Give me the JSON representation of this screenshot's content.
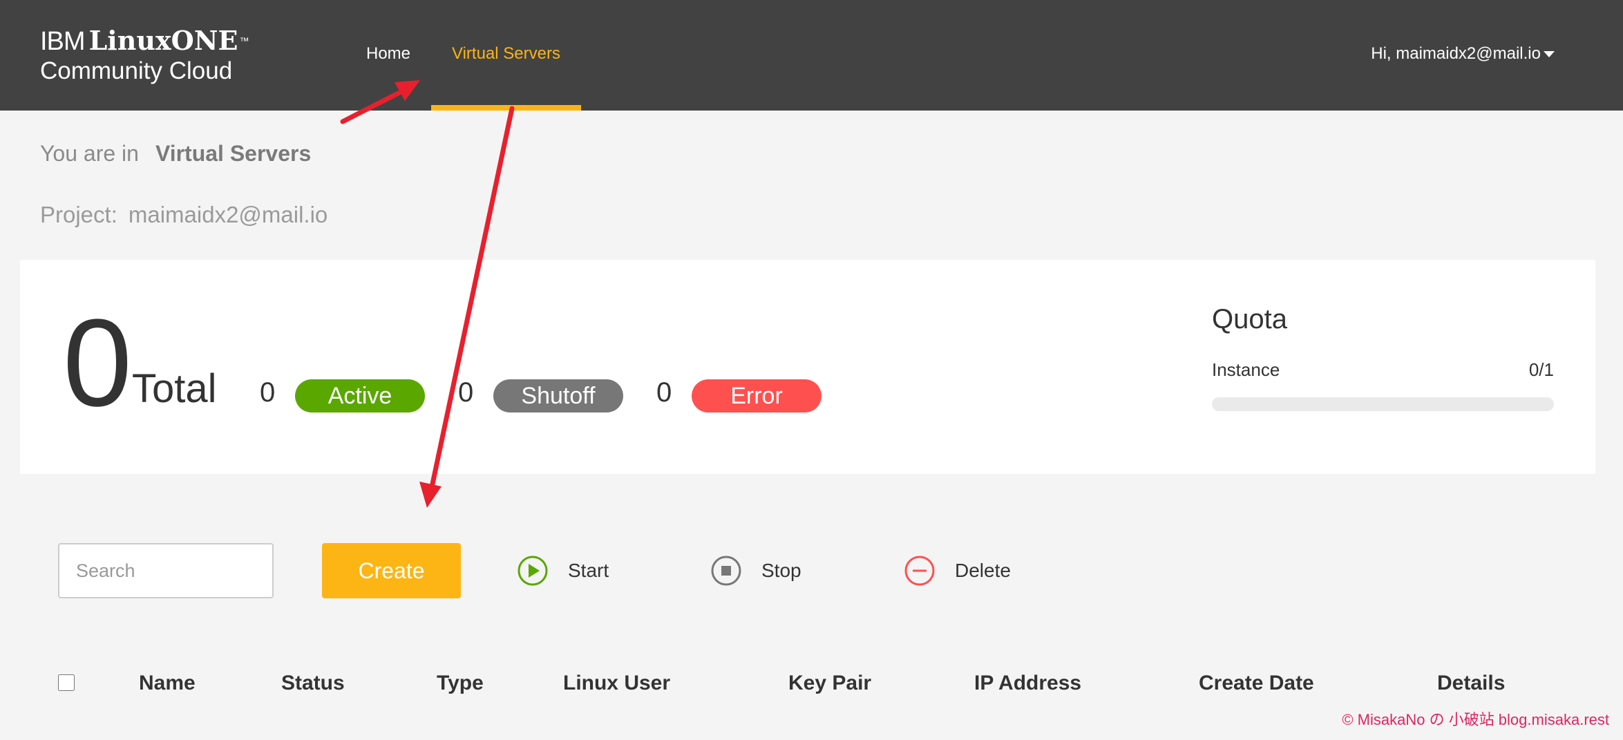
{
  "header": {
    "logo": {
      "ibm": "IBM",
      "linuxone": "LinuxONE",
      "tm": "™",
      "subtitle": "Community Cloud"
    },
    "nav": [
      {
        "label": "Home"
      },
      {
        "label": "Virtual Servers"
      }
    ],
    "user_greeting": "Hi, maimaidx2@mail.io"
  },
  "breadcrumb": {
    "prefix": "You are in",
    "current": "Virtual Servers"
  },
  "project": {
    "label": "Project:",
    "value": "maimaidx2@mail.io"
  },
  "summary": {
    "total": "0",
    "total_label": "Total",
    "statuses": [
      {
        "count": "0",
        "label": "Active",
        "color": "#5aa700"
      },
      {
        "count": "0",
        "label": "Shutoff",
        "color": "#777777"
      },
      {
        "count": "0",
        "label": "Error",
        "color": "#ff5050"
      }
    ]
  },
  "quota": {
    "title": "Quota",
    "instance_label": "Instance",
    "instance_value": "0/1",
    "used_fraction": 0
  },
  "toolbar": {
    "search_placeholder": "Search",
    "create_label": "Create",
    "start_label": "Start",
    "stop_label": "Stop",
    "delete_label": "Delete"
  },
  "table": {
    "columns": [
      "Name",
      "Status",
      "Type",
      "Linux User",
      "Key Pair",
      "IP Address",
      "Create Date",
      "Details"
    ]
  },
  "watermark": "© MisakaNo の 小破站 blog.misaka.rest",
  "colors": {
    "accent": "#fdb515",
    "header_bg": "#424242",
    "annotation": "#e8202e"
  }
}
